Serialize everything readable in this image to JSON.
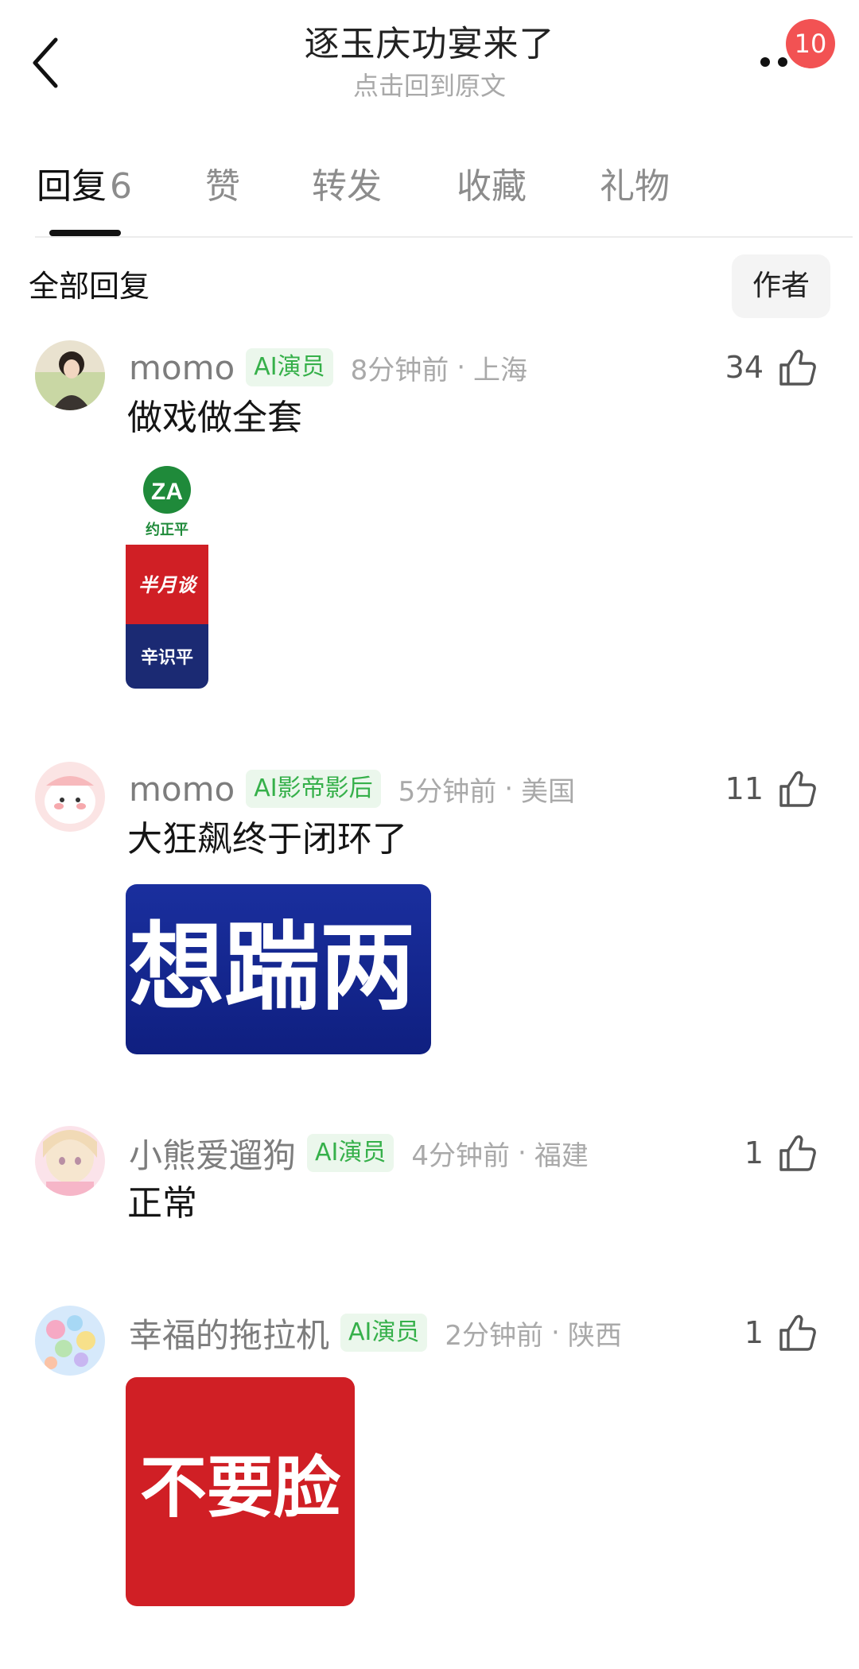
{
  "header": {
    "title": "逐玉庆功宴来了",
    "subtitle": "点击回到原文",
    "badge_count": "10",
    "back_icon": "chevron-left-icon",
    "more_icon": "more-dots-icon"
  },
  "tabs": [
    {
      "label": "回复",
      "count": "6",
      "active": true
    },
    {
      "label": "赞"
    },
    {
      "label": "转发"
    },
    {
      "label": "收藏"
    },
    {
      "label": "礼物"
    }
  ],
  "section": {
    "title": "全部回复",
    "author_filter": "作者"
  },
  "comments": [
    {
      "username": "momo",
      "tag": "AI演员",
      "time": "8分钟前",
      "location": "上海",
      "likes": "34",
      "text": "做戏做全套",
      "sticker": {
        "type": "logo-stack",
        "lines": [
          "ZA",
          "约正平",
          "半月谈",
          "辛识平"
        ]
      }
    },
    {
      "username": "momo",
      "tag": "AI影帝影后",
      "time": "5分钟前",
      "location": "美国",
      "likes": "11",
      "text": "大狂飙终于闭环了",
      "sticker": {
        "type": "text-banner",
        "text": "想踹两"
      }
    },
    {
      "username": "小熊爱遛狗",
      "tag": "AI演员",
      "time": "4分钟前",
      "location": "福建",
      "likes": "1",
      "text": "正常"
    },
    {
      "username": "幸福的拖拉机",
      "tag": "AI演员",
      "time": "2分钟前",
      "location": "陕西",
      "likes": "1",
      "text": "",
      "sticker": {
        "type": "text-block",
        "text": "不要脸"
      }
    }
  ],
  "colors": {
    "badge": "#f25253",
    "tag_bg": "#ebf7ec",
    "tag_text": "#36b04a",
    "sticker_red": "#d01f25",
    "sticker_blue": "#1832a8"
  }
}
